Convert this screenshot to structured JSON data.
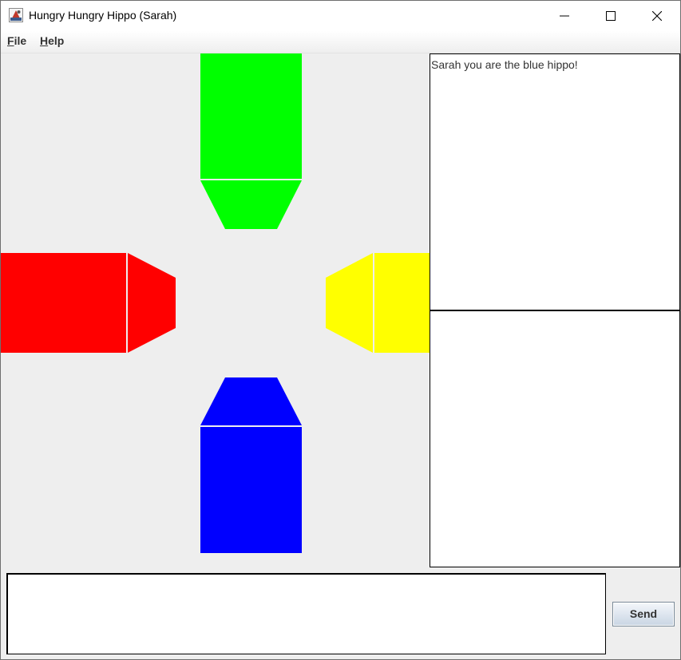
{
  "window": {
    "title": "Hungry Hungry Hippo (Sarah)"
  },
  "menu": {
    "items": [
      {
        "label": "File"
      },
      {
        "label": "Help"
      }
    ]
  },
  "board": {
    "hippos": [
      {
        "color_name": "green",
        "color": "#00ff00"
      },
      {
        "color_name": "red",
        "color": "#ff0000"
      },
      {
        "color_name": "yellow",
        "color": "#ffff00"
      },
      {
        "color_name": "blue",
        "color": "#0000ff"
      }
    ]
  },
  "chat": {
    "messages": [
      "Sarah you are the blue hippo!"
    ],
    "input_value": ""
  },
  "send": {
    "label": "Send"
  },
  "icons": {
    "app": "java-app-icon",
    "minimize": "minimize-icon",
    "maximize": "maximize-icon",
    "close": "close-icon"
  }
}
